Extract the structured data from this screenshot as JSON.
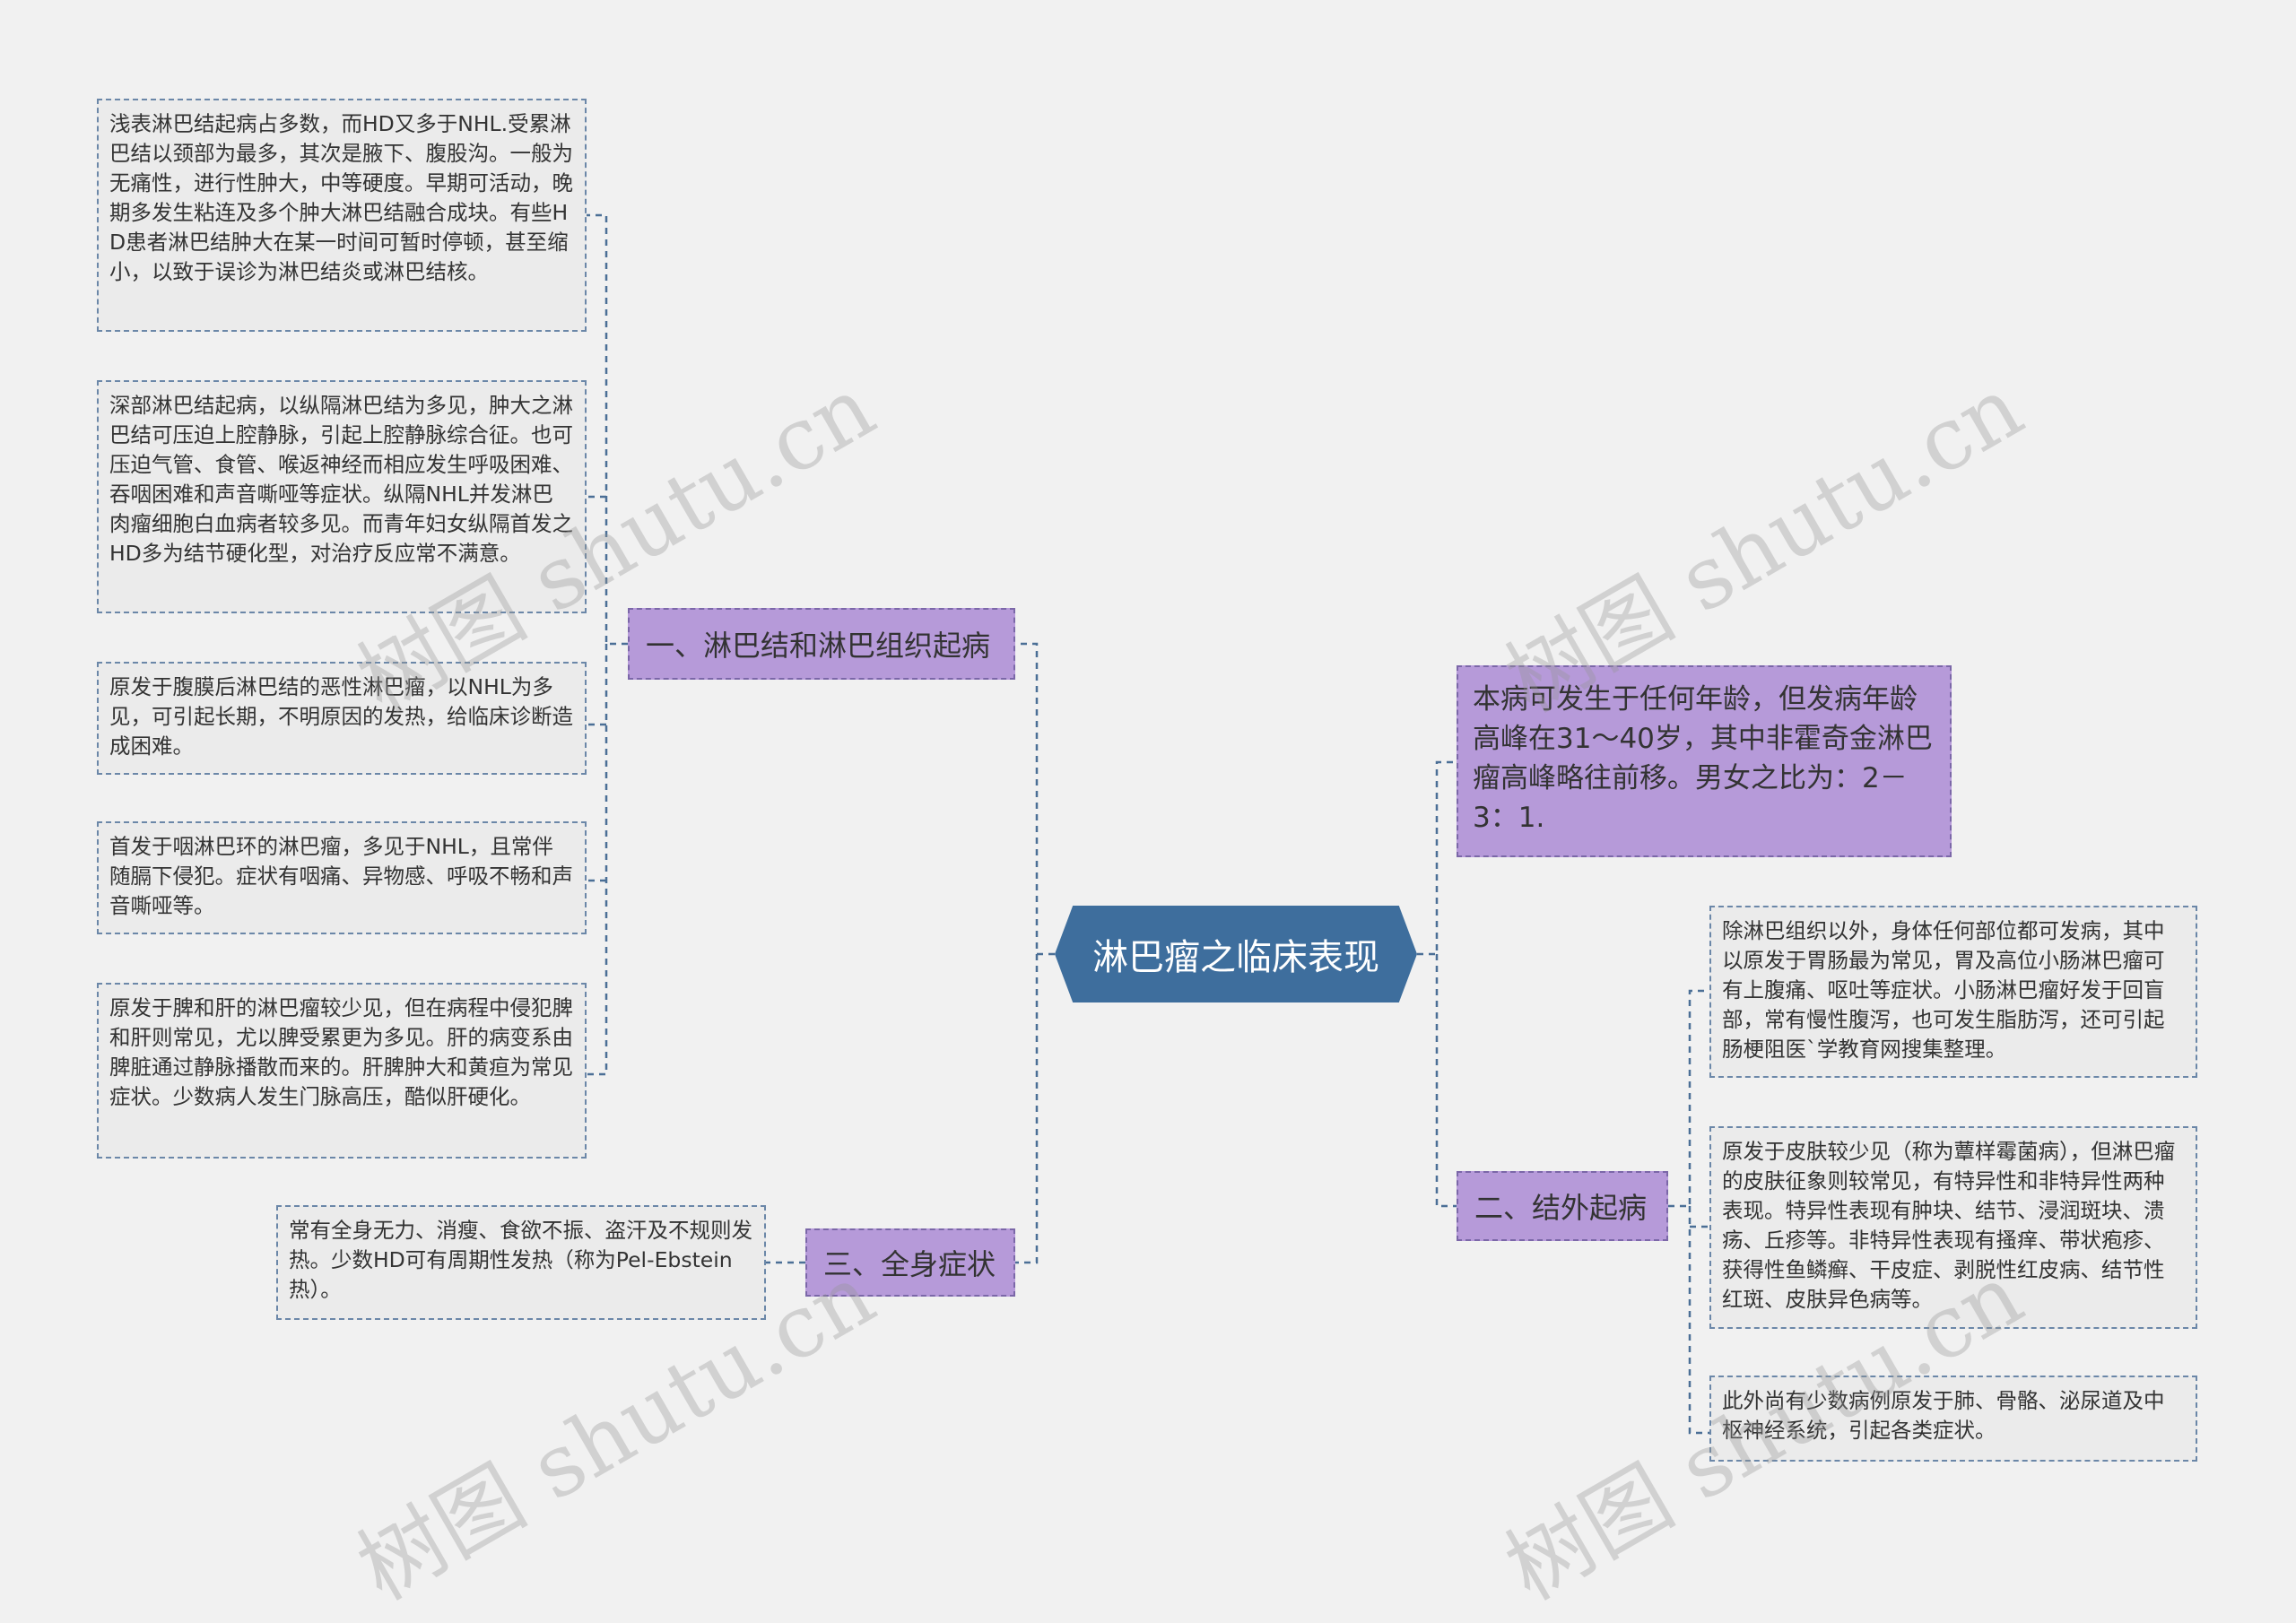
{
  "root": {
    "label": "淋巴瘤之临床表现"
  },
  "branches": {
    "b1": "一、淋巴结和淋巴组织起病",
    "b2": "二、结外起病",
    "b3": "三、全身症状"
  },
  "info": "本病可发生于任何年龄，但发病年龄高峰在31～40岁，其中非霍奇金淋巴瘤高峰略往前移。男女之比为：2－3：1.",
  "leaves": {
    "l1": "浅表淋巴结起病占多数，而HD又多于NHL.受累淋巴结以颈部为最多，其次是腋下、腹股沟。一般为无痛性，进行性肿大，中等硬度。早期可活动，晚期多发生粘连及多个肿大淋巴结融合成块。有些HD患者淋巴结肿大在某一时间可暂时停顿，甚至缩小，以致于误诊为淋巴结炎或淋巴结核。",
    "l2": "深部淋巴结起病，以纵隔淋巴结为多见，肿大之淋巴结可压迫上腔静脉，引起上腔静脉综合征。也可压迫气管、食管、喉返神经而相应发生呼吸困难、吞咽困难和声音嘶哑等症状。纵隔NHL并发淋巴肉瘤细胞白血病者较多见。而青年妇女纵隔首发之HD多为结节硬化型，对治疗反应常不满意。",
    "l3": "原发于腹膜后淋巴结的恶性淋巴瘤，以NHL为多见，可引起长期，不明原因的发热，给临床诊断造成困难。",
    "l4": "首发于咽淋巴环的淋巴瘤，多见于NHL，且常伴随膈下侵犯。症状有咽痛、异物感、呼吸不畅和声音嘶哑等。",
    "l5": "原发于脾和肝的淋巴瘤较少见，但在病程中侵犯脾和肝则常见，尤以脾受累更为多见。肝的病变系由脾脏通过静脉播散而来的。肝脾肿大和黄疸为常见症状。少数病人发生门脉高压，酷似肝硬化。",
    "l6": "常有全身无力、消瘦、食欲不振、盗汗及不规则发热。少数HD可有周期性发热（称为Pel-Ebstein热）。",
    "l7": "除淋巴组织以外，身体任何部位都可发病，其中以原发于胃肠最为常见，胃及高位小肠淋巴瘤可有上腹痛、呕吐等症状。小肠淋巴瘤好发于回盲部，常有慢性腹泻，也可发生脂肪泻，还可引起肠梗阻医`学教育网搜集整理。",
    "l8": "原发于皮肤较少见（称为蕈样霉菌病），但淋巴瘤的皮肤征象则较常见，有特异性和非特异性两种表现。特异性表现有肿块、结节、浸润斑块、溃疡、丘疹等。非特异性表现有搔痒、带状疱疹、获得性鱼鳞癣、干皮症、剥脱性红皮病、结节性红斑、皮肤异色病等。",
    "l9": "此外尚有少数病例原发于肺、骨骼、泌尿道及中枢神经系统，引起各类症状。"
  },
  "watermarks": [
    "树图 shutu.cn",
    "树图 shutu.cn",
    "树图 shutu.cn",
    "树图 shutu.cn"
  ],
  "colors": {
    "root": "#3e6e9d",
    "branch": "#b69ad9",
    "leaf": "#ebebeb",
    "connector": "#4b6f96",
    "background": "#f1f1f1"
  }
}
